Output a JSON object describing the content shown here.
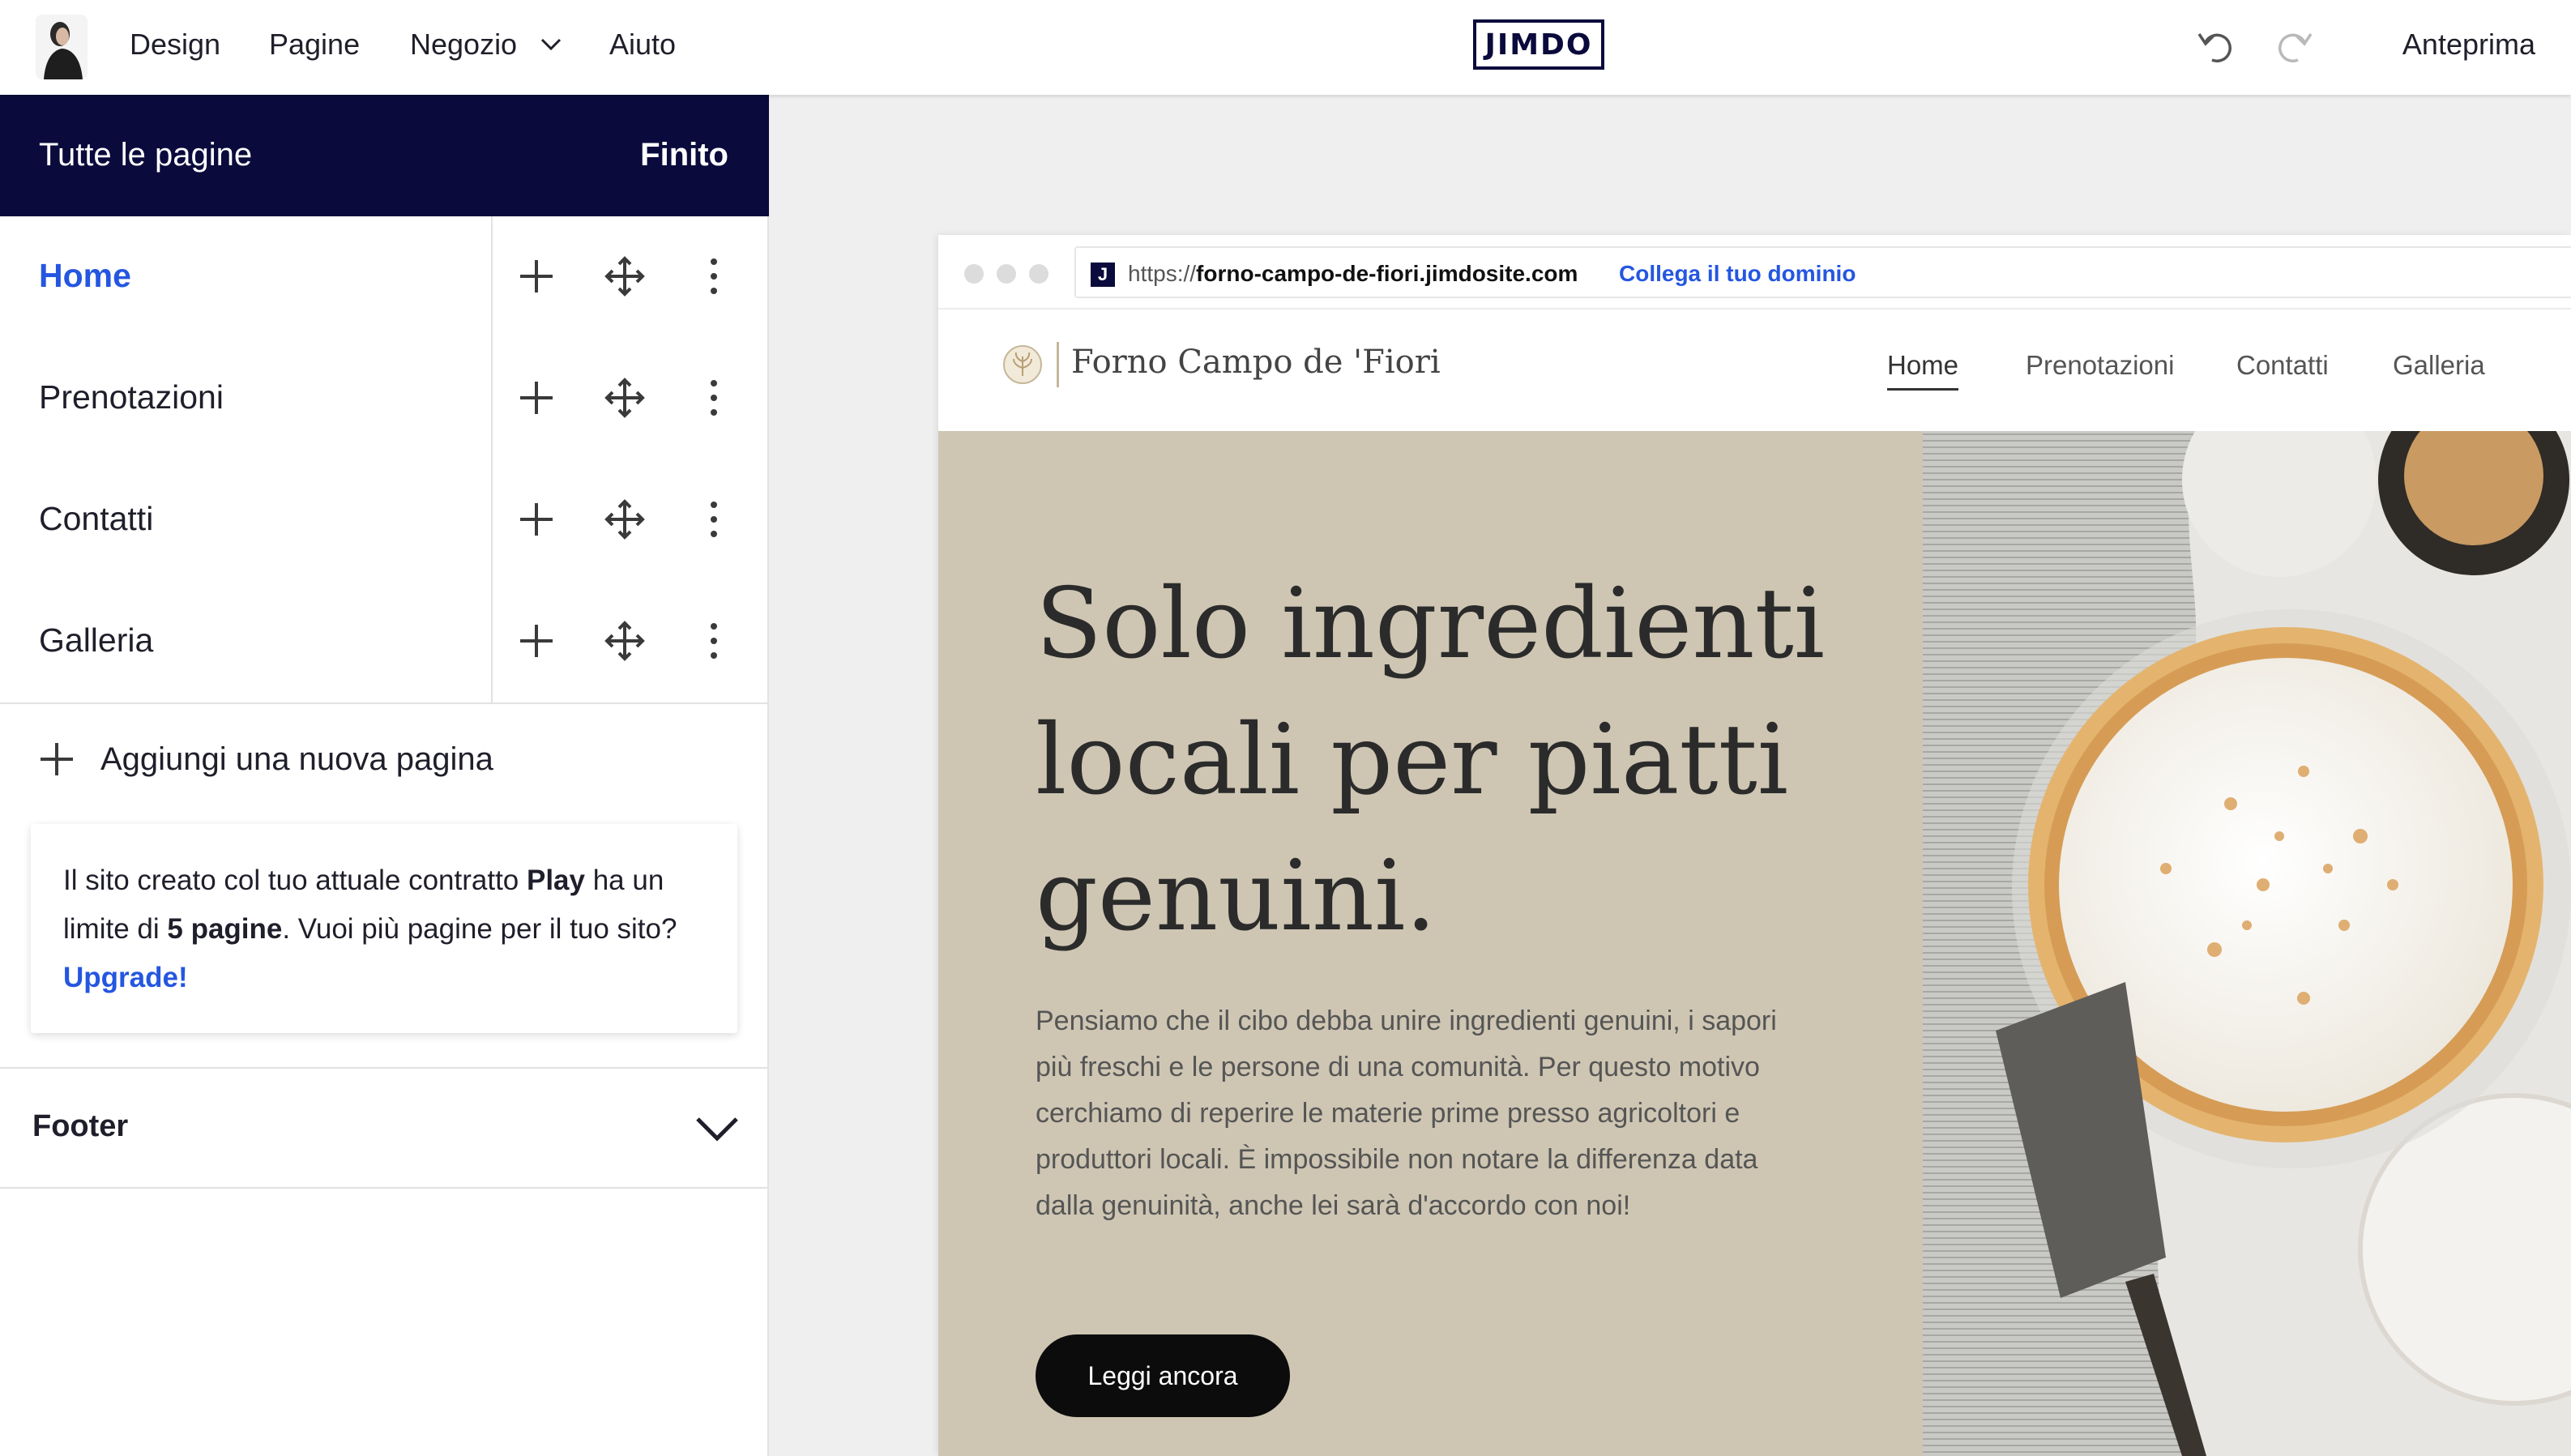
{
  "topbar": {
    "nav": [
      {
        "label": "Design"
      },
      {
        "label": "Pagine"
      },
      {
        "label": "Negozio"
      },
      {
        "label": "Aiuto"
      }
    ],
    "logo": "JIMDO",
    "preview_label": "Anteprima",
    "icons": [
      "avatar",
      "chevron-down-icon",
      "undo-icon",
      "redo-icon"
    ]
  },
  "sidebar": {
    "title": "Tutte le pagine",
    "done_label": "Finito",
    "pages": [
      {
        "label": "Home",
        "active": true
      },
      {
        "label": "Prenotazioni",
        "active": false
      },
      {
        "label": "Contatti",
        "active": false
      },
      {
        "label": "Galleria",
        "active": false
      }
    ],
    "add_page_label": "Aggiungi una nuova pagina",
    "limit_notice": {
      "part1": "Il sito creato col tuo attuale contratto ",
      "plan": "Play",
      "part2": " ha un limite di ",
      "limit": "5 pagine",
      "part3": ". Vuoi più pagine per il tuo sito? ",
      "upgrade": "Upgrade!"
    },
    "footer_label": "Footer"
  },
  "preview": {
    "url_prefix": "https://",
    "url_domain": "forno-campo-de-fiori.jimdosite.com",
    "connect_domain": "Collega il tuo dominio",
    "site_name": "Forno Campo de 'Fiori",
    "site_nav": [
      "Home",
      "Prenotazioni",
      "Contatti",
      "Galleria"
    ],
    "hero_title": "Solo ingredienti locali per piatti genuini.",
    "hero_text": "Pensiamo che il cibo debba unire ingredienti genuini, i sapori più freschi e le persone di una comunità. Per questo motivo cerchiamo di reperire le materie prime presso agricoltori e produttori locali. È impossibile non notare la differenza data dalla genuinità, anche lei sarà d'accordo con noi!",
    "hero_button": "Leggi ancora"
  },
  "colors": {
    "navy": "#0a0a3c",
    "accent_blue": "#2456e0",
    "hero_beige": "#cec6b3"
  }
}
